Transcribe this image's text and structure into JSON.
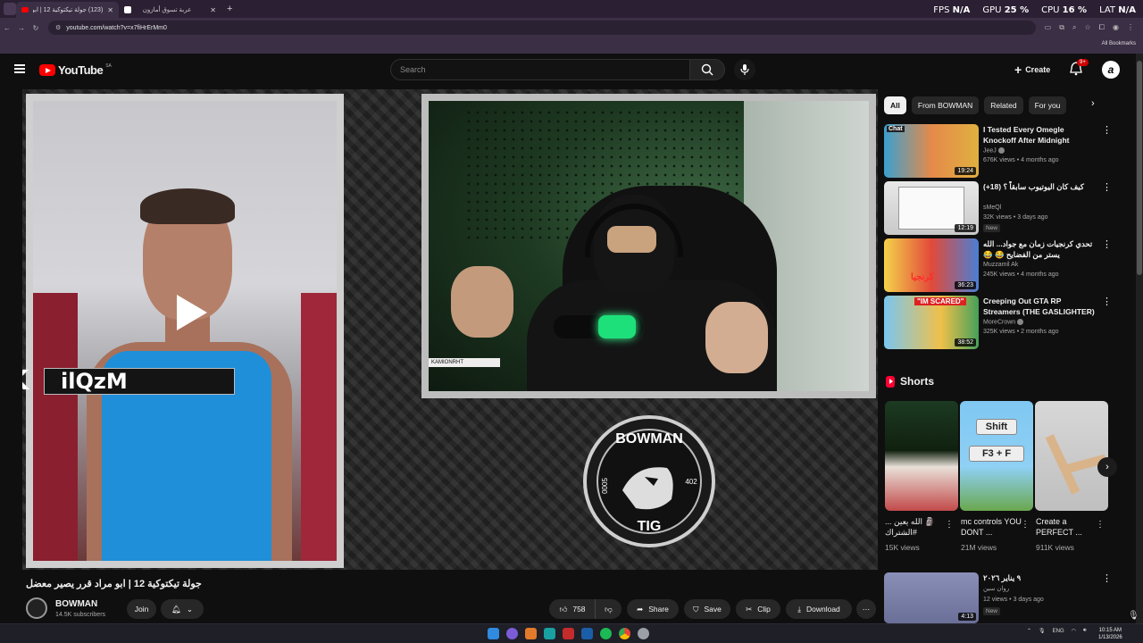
{
  "browser": {
    "tabs": [
      {
        "label": "(123) جولة تيكتوكية 12 | ابو...",
        "active": true
      },
      {
        "label": "عربة تسوق أمازون",
        "active": false
      }
    ],
    "url": "youtube.com/watch?v=x7fiHrErMm0",
    "all_bookmarks": "All Bookmarks",
    "perf": {
      "fps_label": "FPS",
      "fps": "N/A",
      "gpu_label": "GPU",
      "gpu": "25 %",
      "cpu_label": "CPU",
      "cpu": "16 %",
      "lat_label": "LAT",
      "lat": "N/A"
    }
  },
  "header": {
    "logo_text": "YouTube",
    "country": "SA",
    "search_placeholder": "Search",
    "create_label": "Create",
    "notif_count": "9+"
  },
  "video": {
    "overlay_text": "ilQzM",
    "streamer_tag": "KAMIONRHT",
    "badge": {
      "top": "BOWMAN",
      "bottom": "TIG",
      "left": "0005",
      "right": "402"
    },
    "title": "جولة تيكتوكية 12 | ابو مراد قرر يصير معضل",
    "channel": "BOWMAN",
    "subscribers": "14.5K subscribers",
    "join": "Join",
    "likes": "758",
    "share": "Share",
    "save": "Save",
    "clip": "Clip",
    "download": "Download"
  },
  "sidebar": {
    "chips": [
      "All",
      "From BOWMAN",
      "Related",
      "For you"
    ],
    "recs": [
      {
        "title": "I Tested Every Omegle Knockoff After Midnight",
        "channel": "JeeJ",
        "meta": "676K views • 4 months ago",
        "duration": "19:24",
        "new": "",
        "thumb_label": "Chat"
      },
      {
        "title": "كيف كان اليوتيوب سابقاً ؟ (18+)",
        "channel": "sMeQl",
        "meta": "32K views • 3 days ago",
        "duration": "12:19",
        "new": "New",
        "thumb_label": ""
      },
      {
        "title": "تحدي كرنجيات زمان مع جواد... الله يستر من الفضايح 😂 😂",
        "channel": "Muzzamil Ak",
        "meta": "245K views • 4 months ago",
        "duration": "36:23",
        "new": "",
        "thumb_label": "كرنجيا"
      },
      {
        "title": "Creeping Out GTA RP Streamers (THE GASLIGHTER)",
        "channel": "MoreCrown",
        "meta": "325K views • 2 months ago",
        "duration": "38:52",
        "new": "",
        "thumb_label": "\"IM SCARED\""
      }
    ],
    "shorts_label": "Shorts",
    "shorts": [
      {
        "title": "🗿 الله يعين ... #الشتراك",
        "views": "15K views",
        "thumb_text": ""
      },
      {
        "title": "mc controls YOU DONT ...",
        "views": "21M views",
        "thumb_text": "Shift"
      },
      {
        "title": "Create a PERFECT ...",
        "views": "911K views",
        "thumb_text": ""
      }
    ],
    "short_keys": "F3 + F",
    "bottom_rec": {
      "title": "٩ يناير ٢٠٢٦",
      "channel": "روان سين",
      "meta": "12 views • 3 days ago",
      "duration": "4:13",
      "new": "New"
    }
  },
  "taskbar": {
    "lang": "ENG",
    "time": "10:15 AM",
    "date": "1/13/2026"
  }
}
